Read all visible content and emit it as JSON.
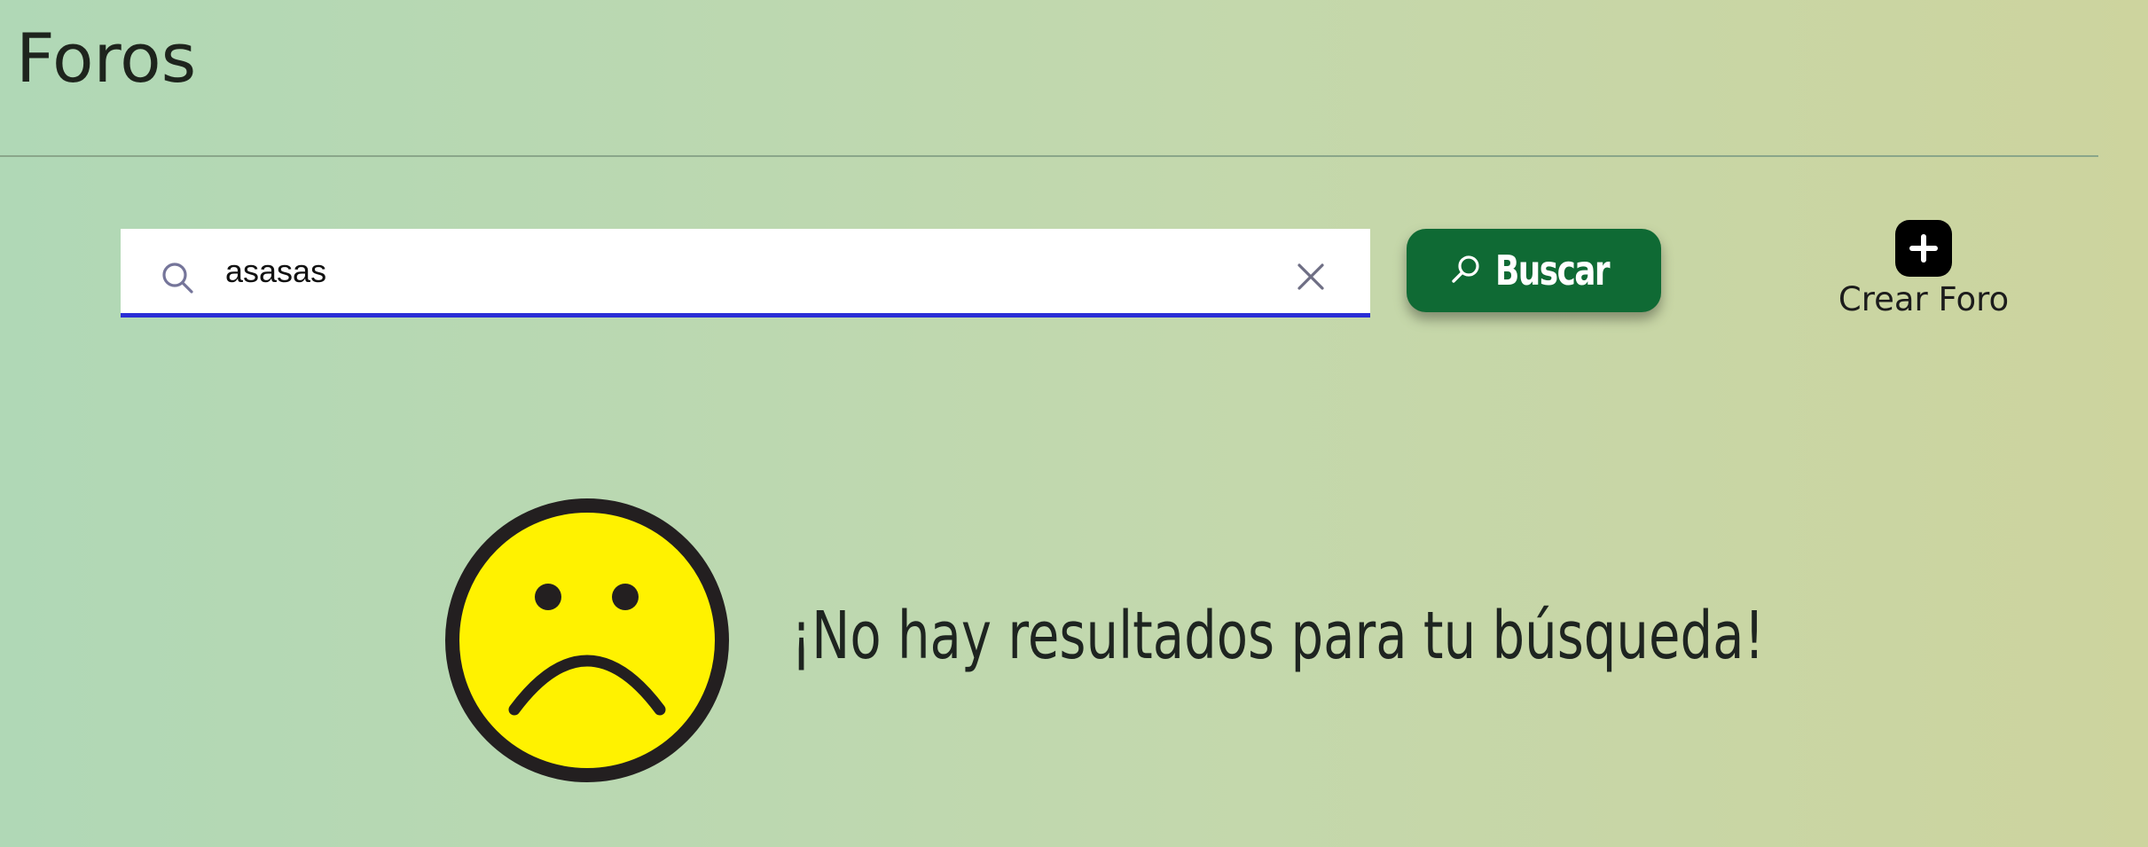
{
  "header": {
    "title": "Foros"
  },
  "search": {
    "value": "asasas",
    "button_label": "Buscar",
    "icons": {
      "search": "search-icon",
      "clear": "close-icon"
    }
  },
  "create_forum": {
    "label": "Crear Foro",
    "icon": "plus-icon"
  },
  "empty_state": {
    "message": "¡No hay resultados para tu búsqueda!",
    "icon": "sad-face-icon"
  },
  "colors": {
    "accent_button": "#0f6a34",
    "input_focus_underline": "#2a2ed6",
    "face_fill": "#fff200"
  }
}
